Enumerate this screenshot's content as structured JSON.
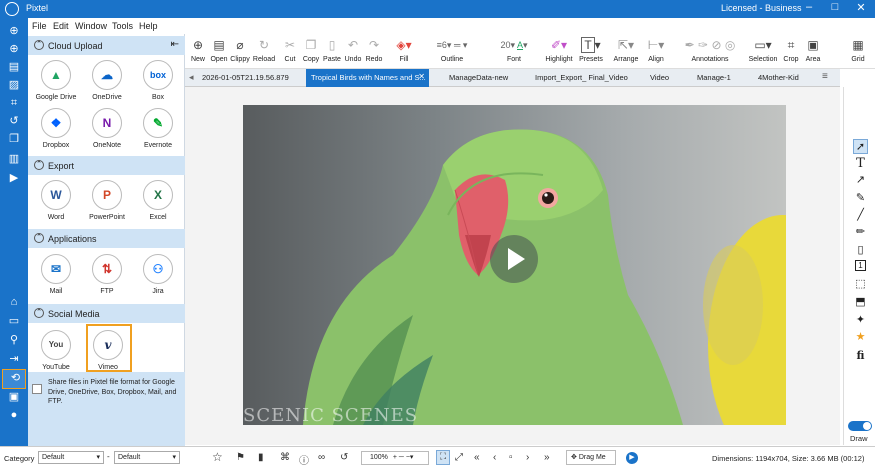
{
  "app": {
    "title": "Pixtel",
    "license": "Licensed - Business"
  },
  "menu": [
    "File",
    "Edit",
    "Window",
    "Tools",
    "Help"
  ],
  "left_strip_icons": [
    "globe-icon",
    "add-circle-icon",
    "document-icon",
    "picture-icon",
    "scan-icon",
    "history-icon",
    "copy-icon",
    "book-icon",
    "video-icon"
  ],
  "left_strip_bottom_icons": [
    "home-icon",
    "folder-icon",
    "search-icon",
    "export-icon",
    "share-icon",
    "contacts-icon",
    "user-icon"
  ],
  "panel": {
    "sections": [
      {
        "title": "Cloud Upload",
        "items": [
          {
            "label": "Google Drive",
            "glyph": "▲",
            "color": "#1fa463"
          },
          {
            "label": "OneDrive",
            "glyph": "☁",
            "color": "#0a64c8"
          },
          {
            "label": "Box",
            "glyph": "box",
            "color": "#0061d5"
          },
          {
            "label": "Dropbox",
            "glyph": "❖",
            "color": "#0061fe"
          },
          {
            "label": "OneNote",
            "glyph": "N",
            "color": "#7719aa"
          },
          {
            "label": "Evernote",
            "glyph": "✎",
            "color": "#00a82d"
          }
        ]
      },
      {
        "title": "Export",
        "items": [
          {
            "label": "Word",
            "glyph": "W",
            "color": "#2b579a"
          },
          {
            "label": "PowerPoint",
            "glyph": "P",
            "color": "#d24726"
          },
          {
            "label": "Excel",
            "glyph": "X",
            "color": "#217346"
          }
        ]
      },
      {
        "title": "Applications",
        "items": [
          {
            "label": "Mail",
            "glyph": "✉",
            "color": "#1a73c9"
          },
          {
            "label": "FTP",
            "glyph": "⇅",
            "color": "#d0342c"
          },
          {
            "label": "Jira",
            "glyph": "⚇",
            "color": "#2684ff"
          }
        ]
      },
      {
        "title": "Social Media",
        "items": [
          {
            "label": "YouTube",
            "glyph": "You",
            "color": "#444444"
          },
          {
            "label": "Vimeo",
            "glyph": "v",
            "color": "#1a2e5a"
          }
        ]
      }
    ],
    "share_text": "Share files in Pixtel file format for Google Drive, OneDrive, Box, Dropbox, Mail, and FTP."
  },
  "toolbar": [
    {
      "label": "New",
      "glyph": "⊕"
    },
    {
      "label": "Open",
      "glyph": "▤"
    },
    {
      "label": "Clippy",
      "glyph": "⌀"
    },
    {
      "label": "Reload",
      "glyph": "↻"
    },
    {
      "label": "Cut",
      "glyph": "✂"
    },
    {
      "label": "Copy",
      "glyph": "❐"
    },
    {
      "label": "Paste",
      "glyph": "📋"
    },
    {
      "label": "Undo",
      "glyph": "↶"
    },
    {
      "label": "Redo",
      "glyph": "↷"
    },
    {
      "label": "Fill",
      "glyph": "◈"
    },
    {
      "label": "Outline",
      "glyph": "═"
    },
    {
      "label": "Font",
      "glyph": "A"
    },
    {
      "label": "Highlight",
      "glyph": "✐"
    },
    {
      "label": "Presets",
      "glyph": "T"
    },
    {
      "label": "Arrange",
      "glyph": "⇱"
    },
    {
      "label": "Align",
      "glyph": "⊢"
    },
    {
      "label": "Annotations",
      "glyph": "✒"
    },
    {
      "label": "Selection",
      "glyph": "▭"
    },
    {
      "label": "Crop",
      "glyph": "⌗"
    },
    {
      "label": "Area",
      "glyph": "▣"
    },
    {
      "label": "Grid",
      "glyph": "▦"
    }
  ],
  "toolbar_values": {
    "line_width": "6",
    "font_size": "20"
  },
  "tabs": [
    {
      "label": "2026-01-05T21.19.56.879",
      "active": false
    },
    {
      "label": "Tropical Birds with Names and S...",
      "active": true
    },
    {
      "label": "ManageData-new",
      "active": false
    },
    {
      "label": "Import_Export_ Final_Video",
      "active": false
    },
    {
      "label": "Video",
      "active": false
    },
    {
      "label": "Manage-1",
      "active": false
    },
    {
      "label": "4Mother-Kid",
      "active": false
    }
  ],
  "video": {
    "watermark": "SCENIC SCENES"
  },
  "right_tools": [
    "pointer-icon",
    "text-icon",
    "arrow-icon",
    "pen-icon",
    "line-icon",
    "marker-icon",
    "page-icon",
    "number-icon",
    "stamp-icon",
    "frame-icon",
    "magic-icon",
    "star-icon",
    "formula-icon"
  ],
  "right_tool_glyphs": [
    "➚",
    "T",
    "↗",
    "✎",
    "╱",
    "✏",
    "▯",
    "1",
    "⬚",
    "⬒",
    "✦",
    "★",
    "fi"
  ],
  "draw": {
    "label": "Draw",
    "on": true
  },
  "bottom": {
    "category_label": "Category",
    "category_value": "Default",
    "second_value": "Default",
    "zoom": "100%",
    "drag_label": "Drag Me",
    "status": "Dimensions: 1194x704, Size: 3.66 MB (00:12)"
  }
}
